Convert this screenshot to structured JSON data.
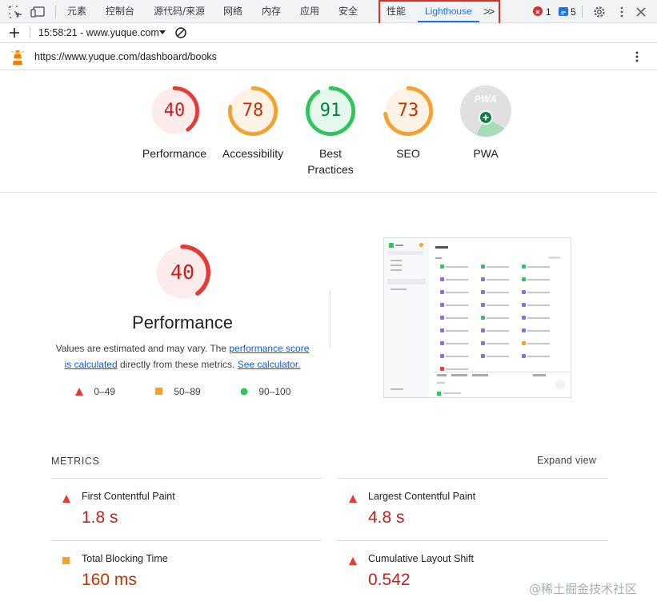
{
  "devtools": {
    "tabs": [
      {
        "label": "元素"
      },
      {
        "label": "控制台"
      },
      {
        "label": "源代码/来源"
      },
      {
        "label": "网络"
      },
      {
        "label": "内存"
      },
      {
        "label": "应用"
      },
      {
        "label": "安全"
      },
      {
        "label": "性能"
      },
      {
        "label": "Lighthouse"
      }
    ],
    "more_tabs_label": ">>",
    "error_count": "1",
    "message_count": "5",
    "report_selector": "15:58:21 - www.yuque.com",
    "url": "https://www.yuque.com/dashboard/books",
    "accent_color": "#1a73e8",
    "highlight_color": "#d93025"
  },
  "summary_gauges": [
    {
      "score": "40",
      "label": "Performance",
      "label_line2": "",
      "rating": "fail",
      "color": "#e63a35",
      "fraction": 0.4
    },
    {
      "score": "78",
      "label": "Accessibility",
      "label_line2": "",
      "rating": "average",
      "color": "#f4a12f",
      "fraction": 0.78
    },
    {
      "score": "91",
      "label": "Best",
      "label_line2": "Practices",
      "rating": "pass",
      "color": "#2ec65a",
      "fraction": 0.91
    },
    {
      "score": "73",
      "label": "SEO",
      "label_line2": "",
      "rating": "average",
      "color": "#f4a12f",
      "fraction": 0.73
    },
    {
      "score": "",
      "label": "PWA",
      "label_line2": "",
      "rating": "pwa",
      "color": "#9e9e9e",
      "fraction": 0
    }
  ],
  "pwa_badge_text": "PWA",
  "performance": {
    "score": "40",
    "fraction": 0.4,
    "title": "Performance",
    "desc_prefix": "Values are estimated and may vary. The ",
    "desc_link1": "performance score",
    "desc_link1b": "is calculated",
    "desc_mid": " directly from these metrics. ",
    "desc_link2": "See calculator."
  },
  "legend": [
    {
      "range": "0–49",
      "shape": "triangle",
      "color": "#e63a35"
    },
    {
      "range": "50–89",
      "shape": "square",
      "color": "#f4a12f"
    },
    {
      "range": "90–100",
      "shape": "circle",
      "color": "#2ec65a"
    }
  ],
  "metrics": {
    "header": "METRICS",
    "expand_label": "Expand view",
    "items": [
      {
        "label": "First Contentful Paint",
        "value": "1.8 s",
        "rating": "fail"
      },
      {
        "label": "Largest Contentful Paint",
        "value": "4.8 s",
        "rating": "fail"
      },
      {
        "label": "Total Blocking Time",
        "value": "160 ms",
        "rating": "average"
      },
      {
        "label": "Cumulative Layout Shift",
        "value": "0.542",
        "rating": "fail"
      }
    ]
  },
  "watermark": "@稀土掘金技术社区"
}
